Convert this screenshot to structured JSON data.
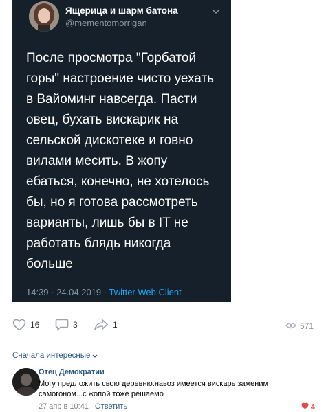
{
  "tweet": {
    "author_name": "Ящерица и шарм батона",
    "author_handle": "@mementomorrigan",
    "lines": [
      "После просмотра \"Горбатой",
      "горы\" настроение чисто уехать",
      "в Вайоминг навсегда. Пасти",
      "овец, бухать вискарик на",
      "сельской дискотеке и говно",
      "вилами месить. В жопу",
      "ебаться, конечно, не хотелось",
      "бы, но я готова рассмотреть",
      "варианты, лишь бы в IT не",
      "работать блядь никогда",
      "больше"
    ],
    "timestamp": "14:39 · 24.04.2019 · ",
    "client": "Twitter Web Client"
  },
  "post_actions": {
    "likes": "16",
    "comments": "3",
    "shares": "1",
    "views": "571"
  },
  "comments_section": {
    "sort_label": "Сначала интересные",
    "comment": {
      "author": "Отец Демократии",
      "text": "Могу предложить свою деревню.навоз имеется вискарь заменим самогоном...с жопой тоже решаемо",
      "date": "27 апр в 10:41",
      "reply_label": "Ответить",
      "likes": "4"
    }
  },
  "colors": {
    "tweet_bg": "#15202b",
    "link": "#2a5885",
    "twitter_blue": "#1da1f2",
    "like_red": "#e64646"
  }
}
